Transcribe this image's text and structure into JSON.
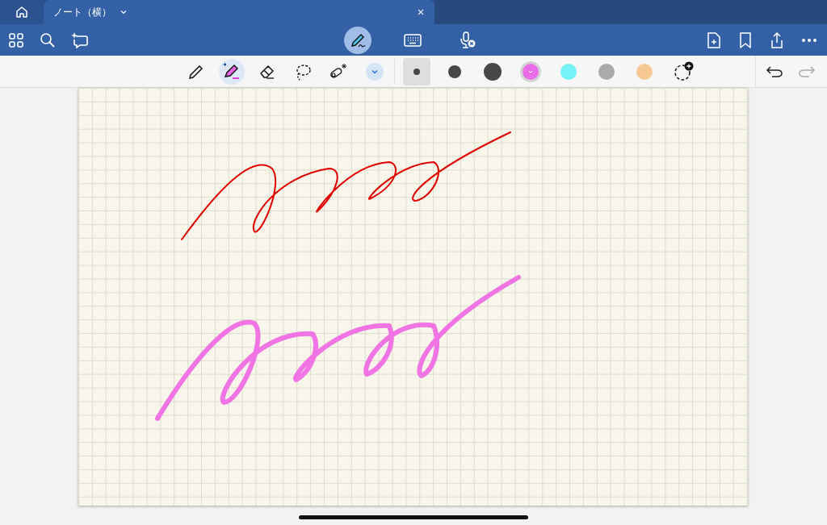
{
  "tab": {
    "title": "ノート（横）"
  },
  "modes": [
    {
      "kind": "pen",
      "selected": true
    },
    {
      "kind": "keyboard",
      "selected": false
    },
    {
      "kind": "mic",
      "selected": false
    }
  ],
  "tools": [
    {
      "kind": "pencil",
      "selected": false
    },
    {
      "kind": "highlighter",
      "selected": true
    },
    {
      "kind": "eraser",
      "selected": false
    },
    {
      "kind": "lasso",
      "selected": false
    },
    {
      "kind": "magic",
      "selected": false
    }
  ],
  "sizes": [
    {
      "kind": "small",
      "selected": true
    },
    {
      "kind": "medium",
      "selected": false
    },
    {
      "kind": "large",
      "selected": false
    }
  ],
  "colors": [
    {
      "color": "#ea6de8",
      "selected": true
    },
    {
      "color": "#72f1f6",
      "selected": false
    },
    {
      "color": "#aaaaaa",
      "selected": false
    },
    {
      "color": "#f8c894",
      "selected": false
    }
  ],
  "history": [
    {
      "kind": "undo",
      "disabled": false
    },
    {
      "kind": "redo",
      "disabled": true
    }
  ],
  "strokes": [
    {
      "color": "#e00000",
      "kind": "thin"
    },
    {
      "color": "#f074e4",
      "kind": "thick"
    }
  ]
}
